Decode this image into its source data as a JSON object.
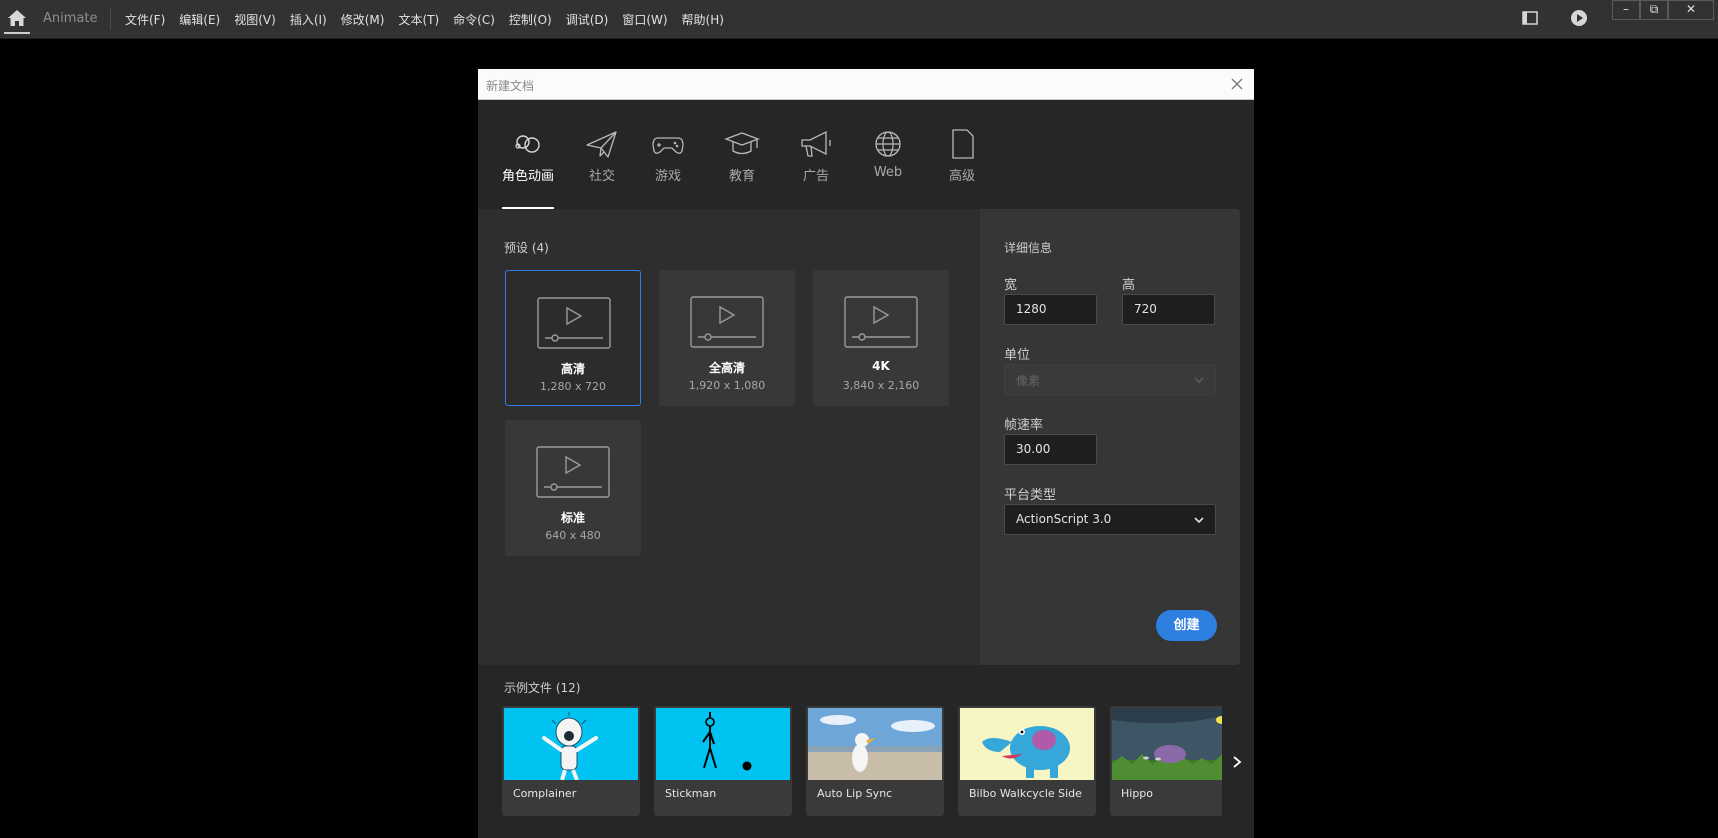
{
  "app": {
    "name": "Animate"
  },
  "menu": [
    "文件(F)",
    "编辑(E)",
    "视图(V)",
    "插入(I)",
    "修改(M)",
    "文本(T)",
    "命令(C)",
    "控制(O)",
    "调试(D)",
    "窗口(W)",
    "帮助(H)"
  ],
  "window_controls": {
    "minimize": "–",
    "restore": "⧉",
    "close": "✕"
  },
  "dialog": {
    "title": "新建文档",
    "categories": [
      {
        "label": "角色动画",
        "icon": "character-animation-icon",
        "active": true
      },
      {
        "label": "社交",
        "icon": "paper-plane-icon"
      },
      {
        "label": "游戏",
        "icon": "gamepad-icon"
      },
      {
        "label": "教育",
        "icon": "graduation-cap-icon"
      },
      {
        "label": "广告",
        "icon": "megaphone-icon"
      },
      {
        "label": "Web",
        "icon": "globe-icon"
      },
      {
        "label": "高级",
        "icon": "document-icon"
      }
    ],
    "presets_label": "预设 (4)",
    "presets": [
      {
        "name": "高清",
        "size": "1,280 x 720",
        "selected": true
      },
      {
        "name": "全高清",
        "size": "1,920 x 1,080"
      },
      {
        "name": "4K",
        "size": "3,840 x 2,160"
      },
      {
        "name": "标准",
        "size": "640 x 480"
      }
    ],
    "details": {
      "title": "详细信息",
      "width_label": "宽",
      "width_value": "1280",
      "height_label": "高",
      "height_value": "720",
      "unit_label": "单位",
      "unit_value": "像素",
      "fps_label": "帧速率",
      "fps_value": "30.00",
      "platform_label": "平台类型",
      "platform_value": "ActionScript 3.0",
      "create_button": "创建"
    },
    "samples_label": "示例文件 (12)",
    "samples": [
      {
        "name": "Complainer",
        "bg": "#00c3f2"
      },
      {
        "name": "Stickman",
        "bg": "#00c3f2"
      },
      {
        "name": "Auto Lip Sync",
        "bg": "#6fa6d8"
      },
      {
        "name": "Bilbo Walkcycle Side",
        "bg": "#f7f5c4"
      },
      {
        "name": "Hippo",
        "bg": "#3e5566"
      }
    ]
  },
  "colors": {
    "accent": "#2d7fe0",
    "menubar": "#323232",
    "dialog_bg": "#262626"
  }
}
